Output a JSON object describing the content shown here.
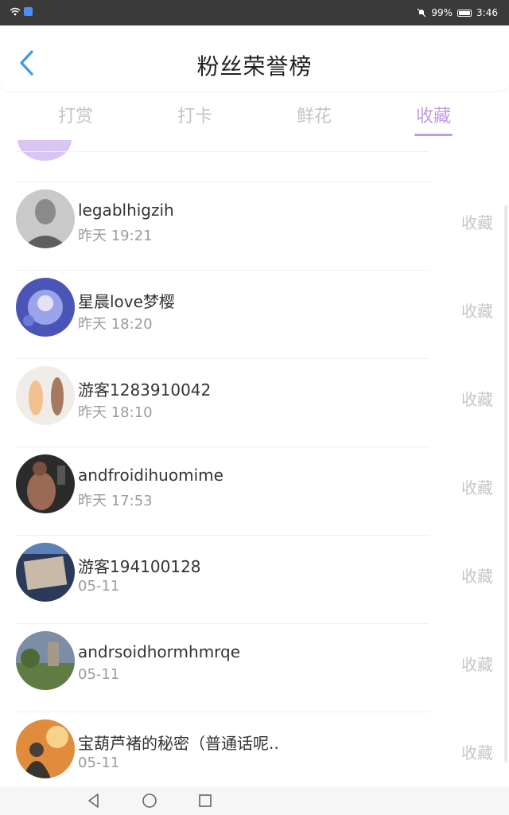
{
  "status": {
    "battery": "99%",
    "time": "3:46"
  },
  "header": {
    "title": "粉丝荣誉榜"
  },
  "tabs": [
    {
      "label": "打赏"
    },
    {
      "label": "打卡"
    },
    {
      "label": "鲜花"
    },
    {
      "label": "收藏"
    }
  ],
  "active_tab": "收藏",
  "list": [
    {
      "name": "legablhigzih",
      "time": "昨天 19:21",
      "action": "收藏"
    },
    {
      "name": "星晨love梦樱",
      "time": "昨天 18:20",
      "action": "收藏"
    },
    {
      "name": "游客1283910042",
      "time": "昨天 18:10",
      "action": "收藏"
    },
    {
      "name": "andfroidihuomime",
      "time": "昨天 17:53",
      "action": "收藏"
    },
    {
      "name": "游客194100128",
      "time": "05-11",
      "action": "收藏"
    },
    {
      "name": "andrsoidhormhmrqe",
      "time": "05-11",
      "action": "收藏"
    },
    {
      "name": "宝葫芦褚的秘密（普通话呢..",
      "time": "05-11",
      "action": "收藏"
    }
  ],
  "colors": {
    "accent": "#c39be0",
    "tab_inactive": "#c4c4c4",
    "time_text": "#9c9c9c",
    "action_text": "#c6c6c6",
    "status_bar": "#3a3a3a",
    "back_arrow": "#3a9be8"
  }
}
